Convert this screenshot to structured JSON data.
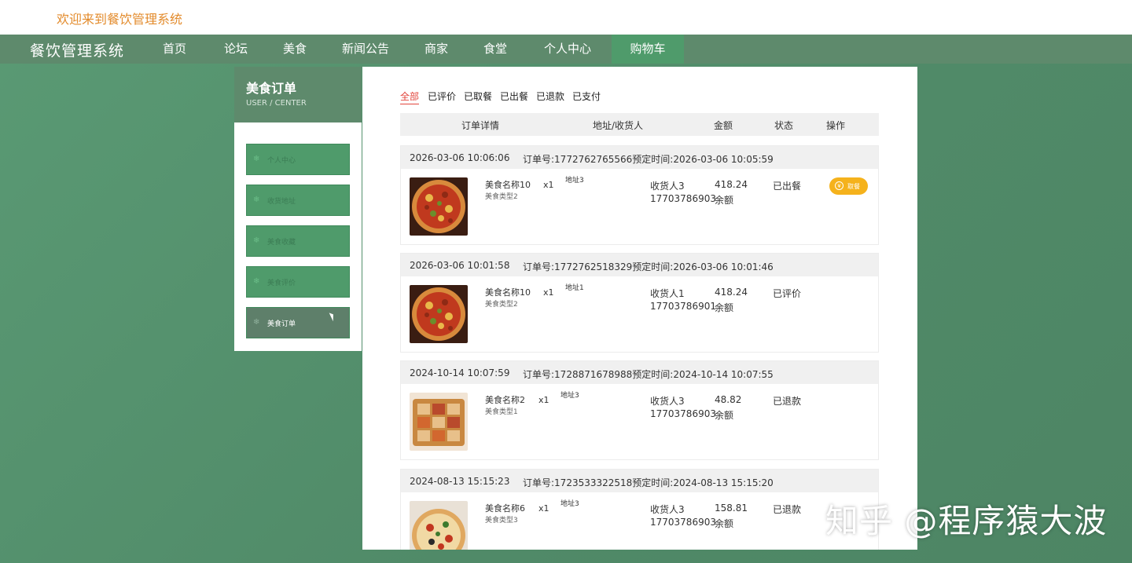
{
  "header": {
    "welcome": "欢迎来到餐饮管理系统",
    "brand": "餐饮管理系统"
  },
  "nav": {
    "items": [
      "首页",
      "论坛",
      "美食",
      "新闻公告",
      "商家",
      "食堂",
      "个人中心",
      "购物车"
    ],
    "active": "购物车"
  },
  "sidebar": {
    "title": "美食订单",
    "subtitle": "USER / CENTER",
    "items": [
      "个人中心",
      "收货地址",
      "美食收藏",
      "美食评价",
      "美食订单"
    ],
    "active": "美食订单"
  },
  "tabs": {
    "items": [
      "全部",
      "已评价",
      "已取餐",
      "已出餐",
      "已退款",
      "已支付"
    ],
    "active": "全部"
  },
  "table_header": {
    "detail": "订单详情",
    "address": "地址/收货人",
    "amount": "金额",
    "status": "状态",
    "action": "操作"
  },
  "orders": [
    {
      "datetime": "2026-03-06 10:06:06",
      "order_line": "订单号:1772762765566预定时间:2026-03-06 10:05:59",
      "food_name": "美食名称10",
      "food_type": "美食类型2",
      "qty": "x1",
      "address": "地址3",
      "receiver": "收货人3",
      "phone": "17703786903",
      "amount": "418.24",
      "pay_method": "余额",
      "status": "已出餐",
      "action": "取餐",
      "image": "pizza"
    },
    {
      "datetime": "2026-03-06 10:01:58",
      "order_line": "订单号:1772762518329预定时间:2026-03-06 10:01:46",
      "food_name": "美食名称10",
      "food_type": "美食类型2",
      "qty": "x1",
      "address": "地址1",
      "receiver": "收货人1",
      "phone": "17703786901",
      "amount": "418.24",
      "pay_method": "余额",
      "status": "已评价",
      "action": "",
      "image": "pizza"
    },
    {
      "datetime": "2024-10-14 10:07:59",
      "order_line": "订单号:1728871678988预定时间:2024-10-14 10:07:55",
      "food_name": "美食名称2",
      "food_type": "美食类型1",
      "qty": "x1",
      "address": "地址3",
      "receiver": "收货人3",
      "phone": "17703786903",
      "amount": "48.82",
      "pay_method": "余额",
      "status": "已退款",
      "action": "",
      "image": "platter"
    },
    {
      "datetime": "2024-08-13 15:15:23",
      "order_line": "订单号:1723533322518预定时间:2024-08-13 15:15:20",
      "food_name": "美食名称6",
      "food_type": "美食类型3",
      "qty": "x1",
      "address": "地址3",
      "receiver": "收货人3",
      "phone": "17703786903",
      "amount": "158.81",
      "pay_method": "余额",
      "status": "已退款",
      "action": "",
      "image": "pizza2"
    }
  ],
  "watermark": "知乎 @程序猿大波",
  "colors": {
    "nav_bg": "#5e8a6c",
    "nav_active": "#4f9b6b",
    "welcome": "#e38b2c",
    "tab_active": "#e2453c",
    "take_button": "#f5b21c"
  }
}
